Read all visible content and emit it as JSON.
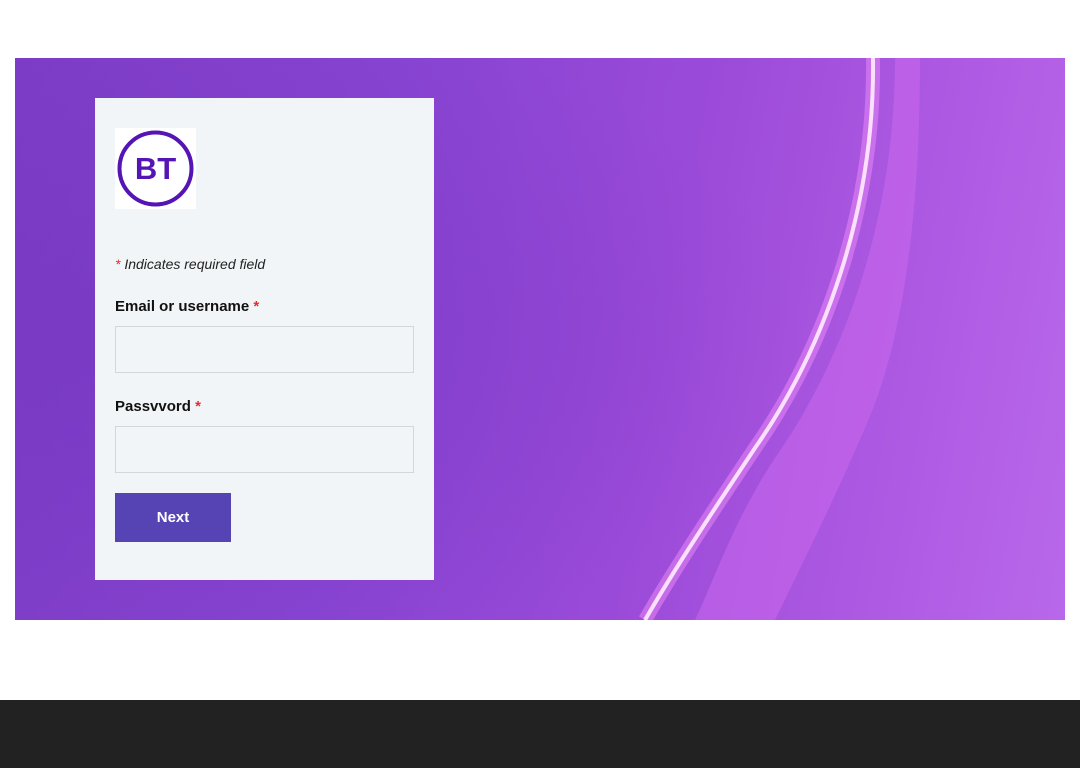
{
  "login": {
    "logo_text": "BT",
    "required_asterisk": "*",
    "required_note": "Indicates required field",
    "email_label": "Email or username",
    "email_value": "",
    "password_label": "Passvvord",
    "password_value": "",
    "next_label": "Next"
  },
  "colors": {
    "brand_purple": "#5514b4",
    "button": "#5644b4",
    "card_background": "#f2f5f7",
    "required_asterisk": "#e52d2d",
    "footer": "#222222"
  },
  "icons": {
    "logo": "bt-logo-icon"
  }
}
